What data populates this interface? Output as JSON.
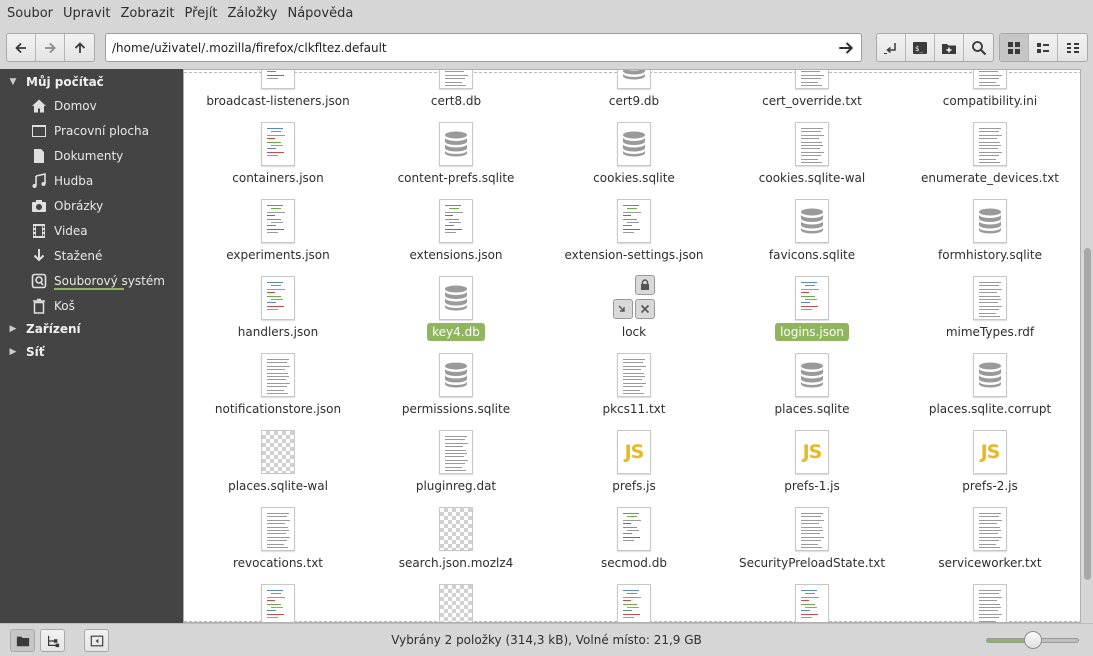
{
  "menu": [
    "Soubor",
    "Upravit",
    "Zobrazit",
    "Přejít",
    "Záložky",
    "Nápověda"
  ],
  "location": {
    "path": "/home/uživatel/.mozilla/firefox/clkfltez.default"
  },
  "sidebar": {
    "sections": [
      {
        "label": "Můj počítač",
        "expanded": true
      },
      {
        "label": "Zařízení",
        "expanded": false
      },
      {
        "label": "Síť",
        "expanded": false
      }
    ],
    "places": [
      {
        "label": "Domov",
        "icon": "home-icon"
      },
      {
        "label": "Pracovní plocha",
        "icon": "folder-icon"
      },
      {
        "label": "Dokumenty",
        "icon": "document-icon"
      },
      {
        "label": "Hudba",
        "icon": "music-icon"
      },
      {
        "label": "Obrázky",
        "icon": "camera-icon"
      },
      {
        "label": "Videa",
        "icon": "film-icon"
      },
      {
        "label": "Stažené",
        "icon": "download-icon"
      },
      {
        "label": "Souborový systém",
        "icon": "drive-icon"
      },
      {
        "label": "Koš",
        "icon": "trash-icon"
      }
    ]
  },
  "files": [
    {
      "name": "broadcast-listeners.json",
      "type": "code"
    },
    {
      "name": "cert8.db",
      "type": "text"
    },
    {
      "name": "cert9.db",
      "type": "database"
    },
    {
      "name": "cert_override.txt",
      "type": "text"
    },
    {
      "name": "compatibility.ini",
      "type": "text"
    },
    {
      "name": "containers.json",
      "type": "code"
    },
    {
      "name": "content-prefs.sqlite",
      "type": "database"
    },
    {
      "name": "cookies.sqlite",
      "type": "database"
    },
    {
      "name": "cookies.sqlite-wal",
      "type": "text"
    },
    {
      "name": "enumerate_devices.txt",
      "type": "text"
    },
    {
      "name": "experiments.json",
      "type": "code"
    },
    {
      "name": "extensions.json",
      "type": "code"
    },
    {
      "name": "extension-settings.json",
      "type": "code"
    },
    {
      "name": "favicons.sqlite",
      "type": "database"
    },
    {
      "name": "formhistory.sqlite",
      "type": "database"
    },
    {
      "name": "handlers.json",
      "type": "code"
    },
    {
      "name": "key4.db",
      "type": "database",
      "selected": true
    },
    {
      "name": "lock",
      "type": "symlink"
    },
    {
      "name": "logins.json",
      "type": "code",
      "selected": true
    },
    {
      "name": "mimeTypes.rdf",
      "type": "text"
    },
    {
      "name": "notificationstore.json",
      "type": "text"
    },
    {
      "name": "permissions.sqlite",
      "type": "database"
    },
    {
      "name": "pkcs11.txt",
      "type": "text"
    },
    {
      "name": "places.sqlite",
      "type": "database"
    },
    {
      "name": "places.sqlite.corrupt",
      "type": "database"
    },
    {
      "name": "places.sqlite-wal",
      "type": "binary"
    },
    {
      "name": "pluginreg.dat",
      "type": "text"
    },
    {
      "name": "prefs.js",
      "type": "javascript"
    },
    {
      "name": "prefs-1.js",
      "type": "javascript"
    },
    {
      "name": "prefs-2.js",
      "type": "javascript"
    },
    {
      "name": "revocations.txt",
      "type": "text"
    },
    {
      "name": "search.json.mozlz4",
      "type": "binary"
    },
    {
      "name": "secmod.db",
      "type": "code"
    },
    {
      "name": "SecurityPreloadState.txt",
      "type": "text"
    },
    {
      "name": "serviceworker.txt",
      "type": "text"
    },
    {
      "name": "",
      "type": "code"
    },
    {
      "name": "",
      "type": "binary"
    },
    {
      "name": "",
      "type": "code"
    },
    {
      "name": "",
      "type": "code"
    },
    {
      "name": "",
      "type": "text"
    }
  ],
  "status": {
    "text": "Vybrány 2 položky (314,3 kB), Volné místo: 21,9 GB"
  },
  "zoom": {
    "level": 0.5
  },
  "colors": {
    "accent": "#8fb55f",
    "sidebar": "#444444"
  }
}
